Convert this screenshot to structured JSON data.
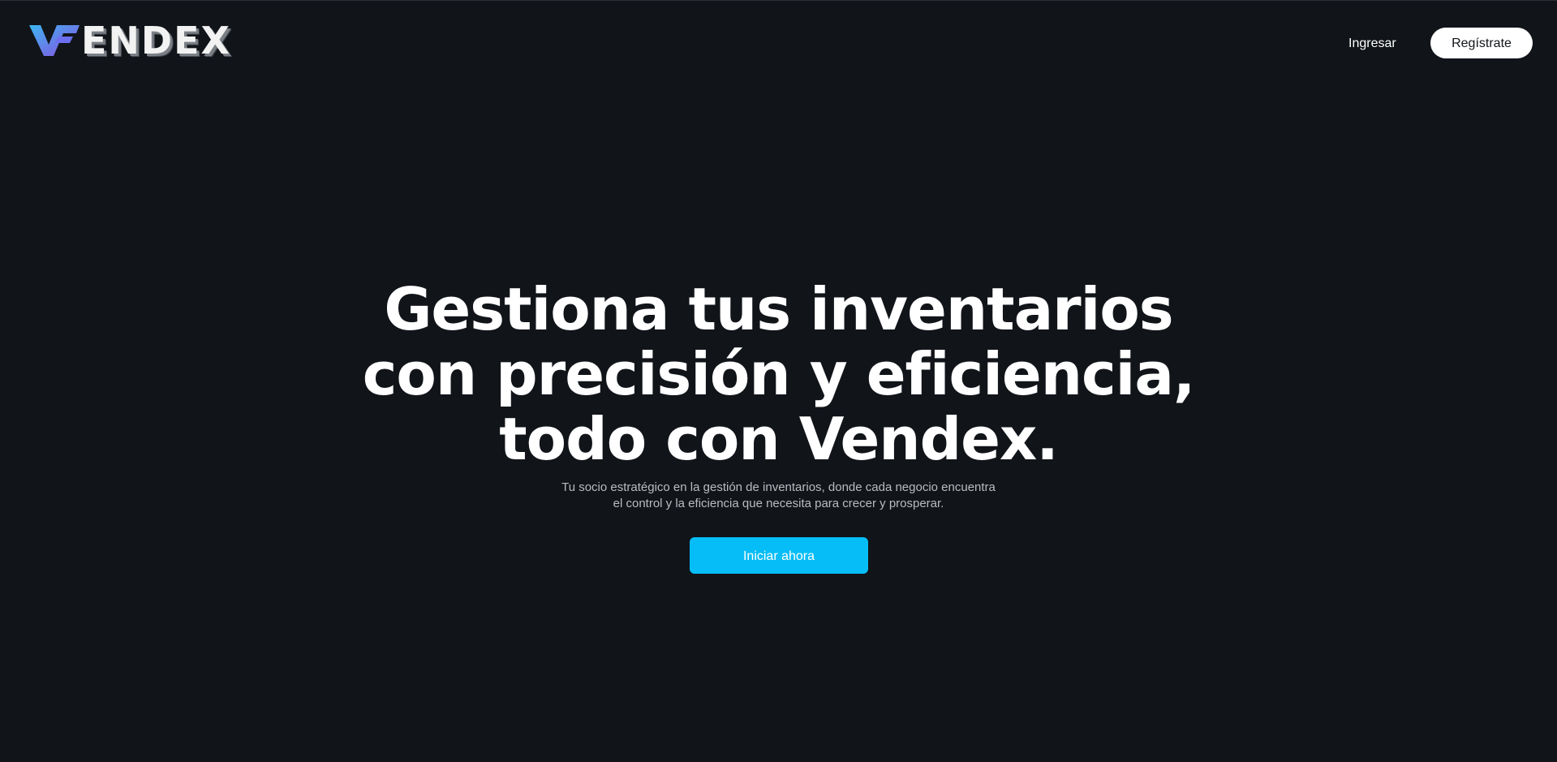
{
  "brand": {
    "name": "ENDEX",
    "mark_icon": "vendex-v-logo-icon",
    "colors": {
      "mark_gradient_start": "#3db6f2",
      "mark_gradient_end": "#8a4de0",
      "text": "#f2f2f2"
    }
  },
  "header": {
    "login_label": "Ingresar",
    "register_label": "Regístrate"
  },
  "hero": {
    "title_lines": [
      "Gestiona tus inventarios",
      "con precisión y eficiencia,",
      "todo con Vendex."
    ],
    "subtitle_lines": [
      "Tu socio estratégico en la gestión de inventarios, donde cada negocio encuentra",
      "el control y la eficiencia que necesita para crecer y prosperar."
    ],
    "cta_label": "Iniciar ahora"
  },
  "colors": {
    "background": "#111419",
    "accent": "#06bdf7",
    "register_button_bg": "#ffffff",
    "subtitle_text": "#b9bcc1"
  }
}
